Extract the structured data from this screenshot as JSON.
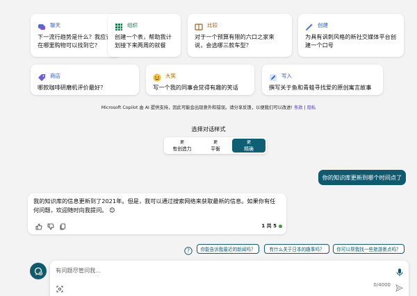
{
  "prompt_cards": [
    {
      "category": "聊天",
      "icon": "chat-icon",
      "text": "下一流行趋势是什么？我应该在哪里购物可以找到它?"
    },
    {
      "category": "组织",
      "icon": "grid-icon",
      "text": "创建一个表，帮助我计划接下来两周的就餐"
    },
    {
      "category": "比较",
      "icon": "scale-icon",
      "text": "对于一个预算有限的六口之家来说，会选哪三款车型？"
    },
    {
      "category": "创建",
      "icon": "magic-wand-icon",
      "text": "为具有讽刺风格的新社交媒体平台创建一个口号"
    },
    {
      "category": "商店",
      "icon": "tag-icon",
      "text": "哪款咖啡研磨机评价最好？"
    },
    {
      "category": "大笑",
      "icon": "smile-icon",
      "text": "写一个我的同事会觉得有趣的笑话"
    },
    {
      "category": "写入",
      "icon": "pencil-icon",
      "text": "撰写关于鱼和青蛙寻找爱的原创寓言故事"
    }
  ],
  "disclaimer": {
    "text": "Microsoft Copilot 由 AI 提供支持，因此可能会出现意外和错误。请分享反馈，以便我们可以改进!",
    "terms_link": "条款",
    "privacy_link": "隐私"
  },
  "conversation_style": {
    "title": "选择对话样式",
    "options": [
      {
        "mark": "更",
        "label": "有创造力"
      },
      {
        "mark": "更",
        "label": "平衡"
      },
      {
        "mark": "更",
        "label": "精确"
      }
    ],
    "selected": "精确"
  },
  "chat": {
    "user_message": "你的知识库更新到哪个时间点了",
    "bot_message": "我的知识库的信息更新到了2021年。但是，我可以通过搜索网络来获取最新的信息。如果你有任何问题，欢迎随时向我提问。",
    "bot_emoji": "😊",
    "turn_counter": "1 共 5"
  },
  "suggestions": [
    "你能告诉我最近的新闻吗？",
    "有什么关于日本的趣事吗？",
    "你可以帮我找一些旅游景点吗？"
  ],
  "input": {
    "placeholder": "有问题尽管问我...",
    "char_count": "0/4000"
  },
  "colors": {
    "accent": "#0f5a6e",
    "chat_cat": "#2b63c7",
    "organize_cat": "#1f7a4a",
    "compare_cat": "#a05a1c",
    "create_cat": "#2b63c7",
    "shop_cat": "#2b63c7",
    "laugh_cat": "#b56a00",
    "write_cat": "#2b63c7"
  }
}
